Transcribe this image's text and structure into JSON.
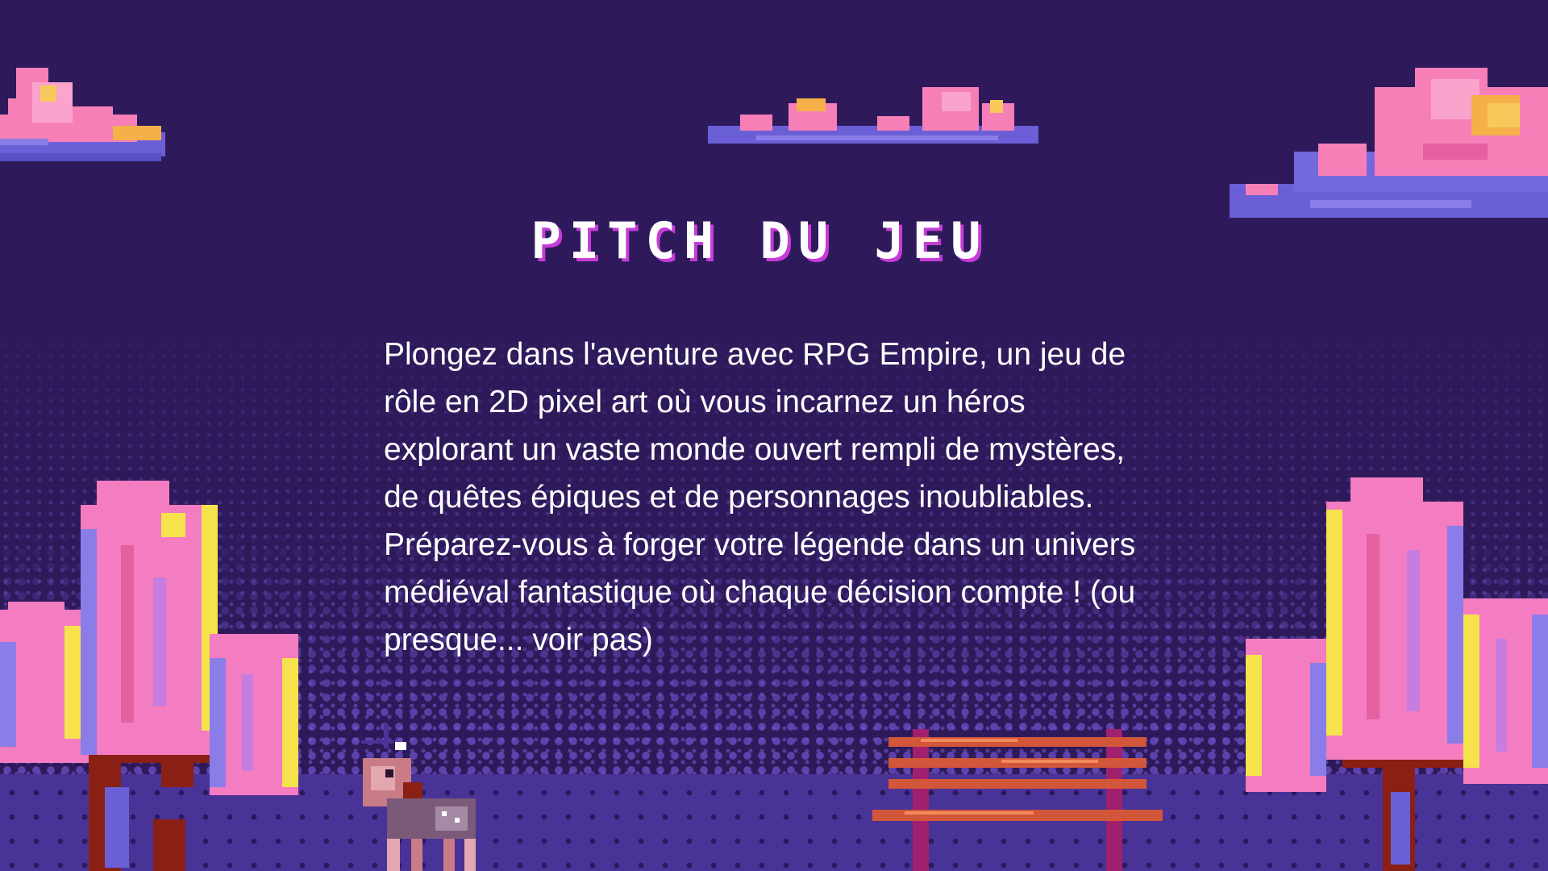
{
  "slide": {
    "title": "PITCH DU JEU",
    "body": "Plongez dans l'aventure avec RPG Empire, un jeu de rôle en 2D pixel art où vous incarnez un héros explorant un vaste monde ouvert rempli de mystères, de quêtes épiques et de personnages inoubliables. Préparez-vous à forger votre légende dans un univers médiéval fantastique où chaque décision compte ! (ou presque... voir pas)"
  },
  "palette": {
    "background": "#2e1a5a",
    "title_shadow": "#c63cd8",
    "cloud_pink": "#f77fb8",
    "cloud_blue": "#6a5fd6",
    "tree_pink": "#f47cc0",
    "tree_yellow": "#f6e34c",
    "trunk": "#8a1f14",
    "bench": "#d2563a"
  },
  "decor": {
    "icons": [
      "cloud-icon",
      "cloud-icon",
      "cloud-icon",
      "tree-icon",
      "tree-icon",
      "deer-icon",
      "bench-icon"
    ]
  }
}
